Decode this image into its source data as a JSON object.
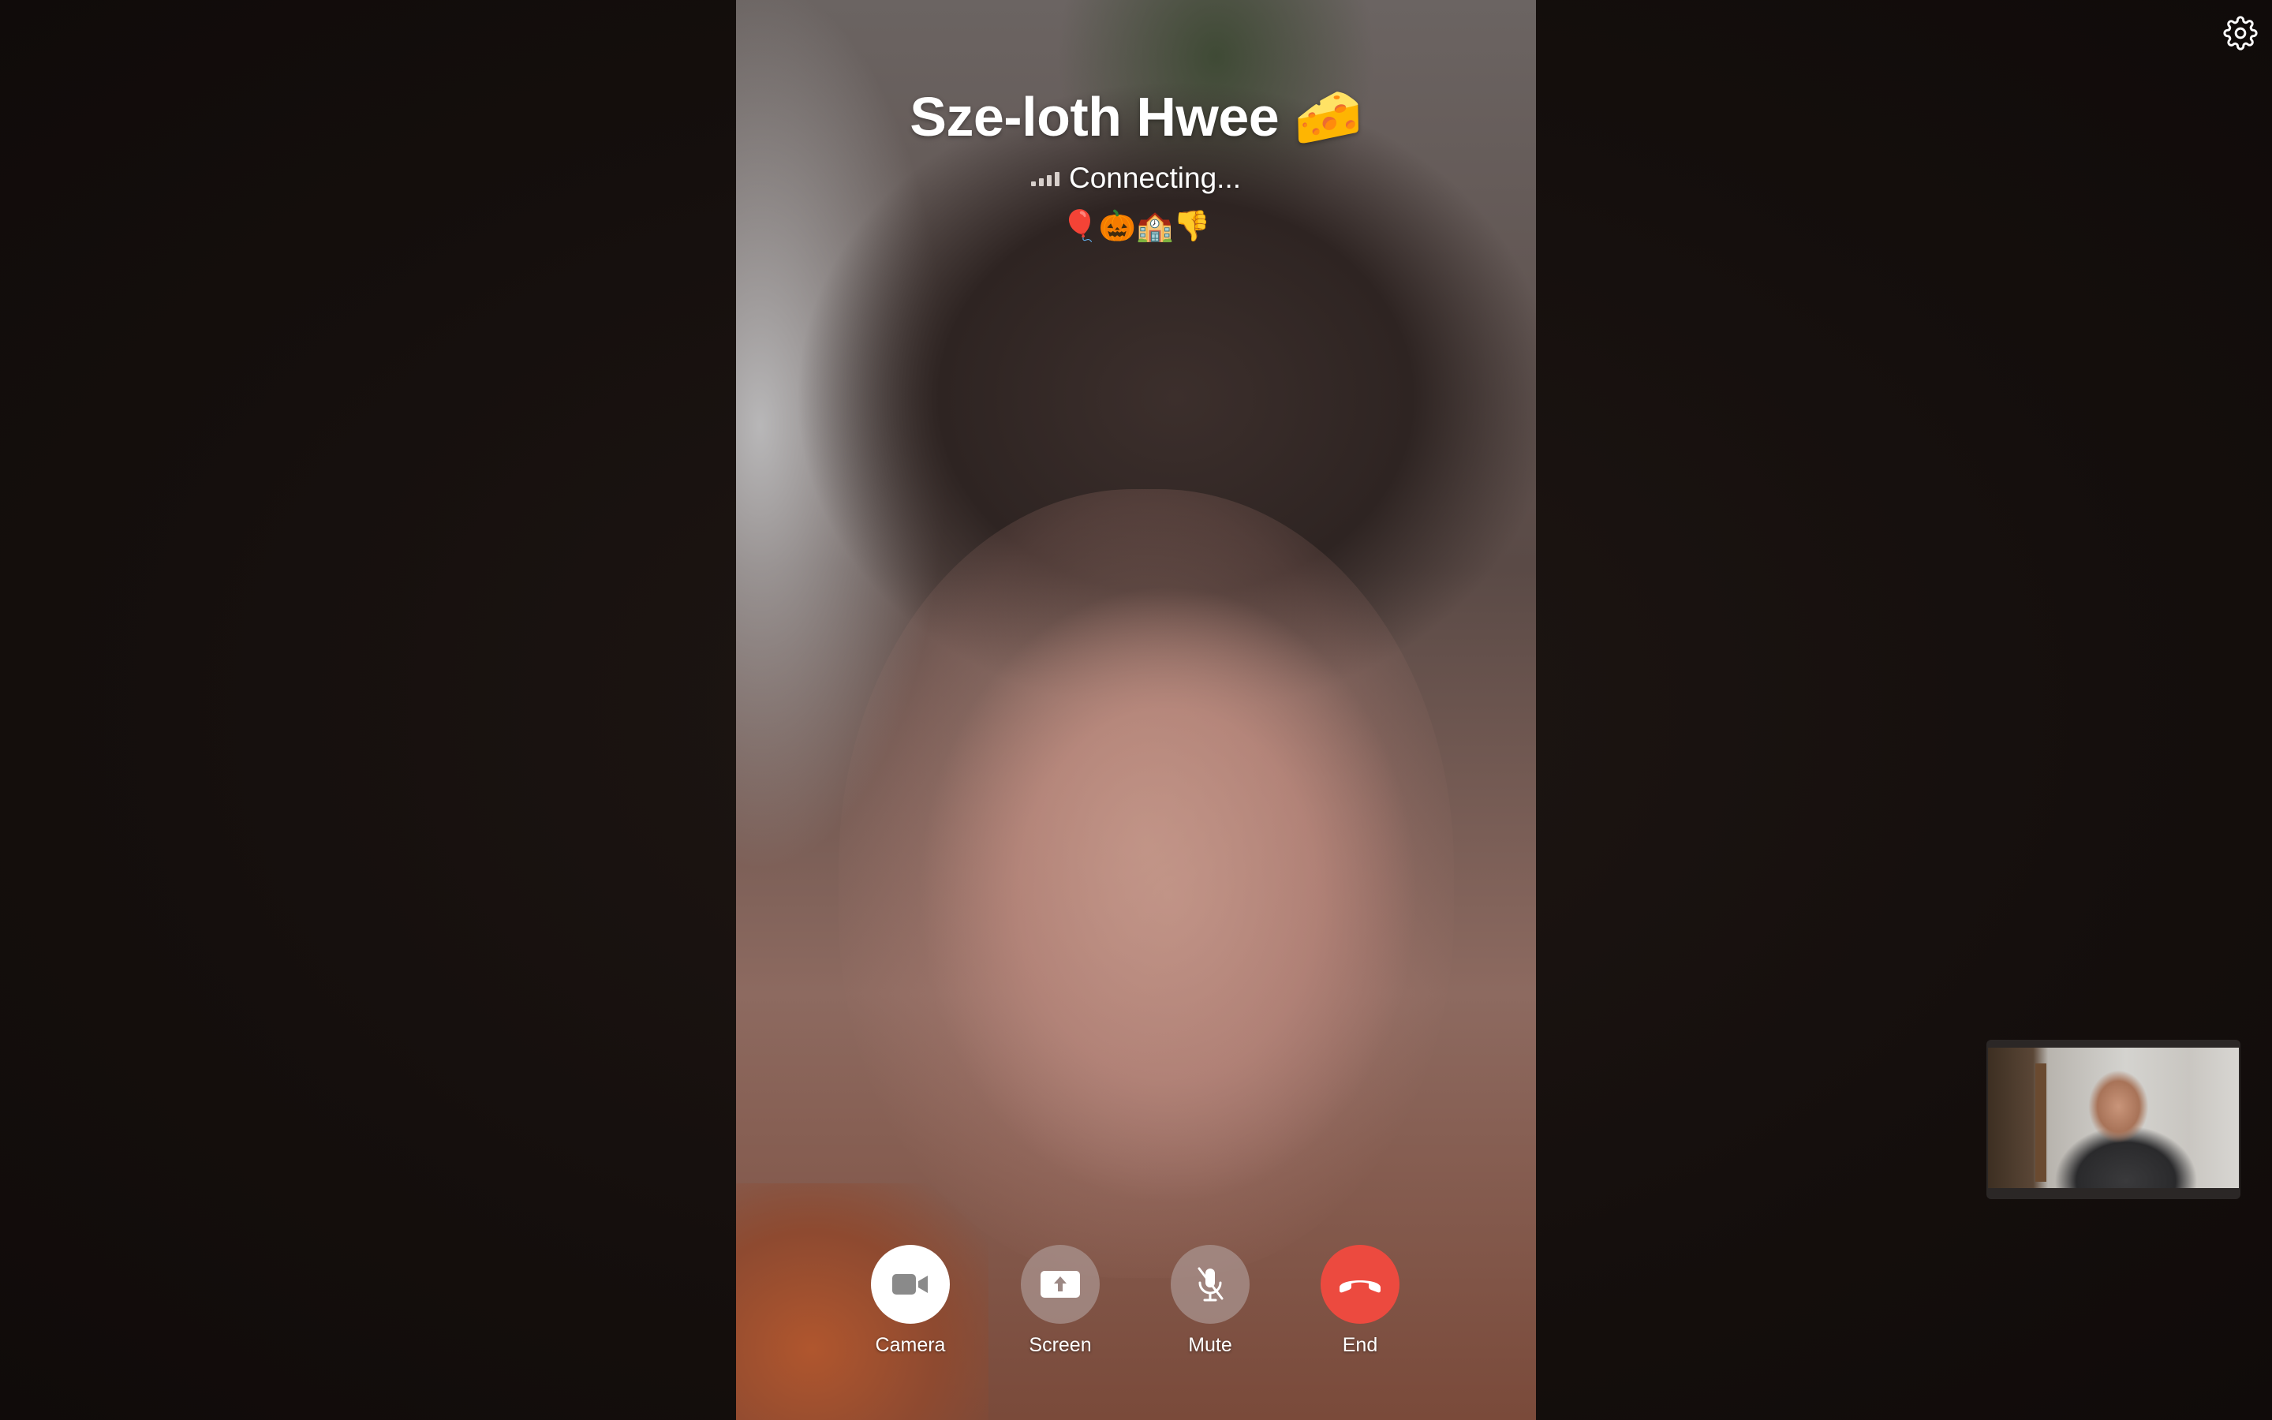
{
  "call": {
    "caller_name": "Sze-loth Hwee 🧀",
    "status": "Connecting...",
    "emojis": "🎈🎃🏫👎"
  },
  "controls": {
    "camera_label": "Camera",
    "screen_label": "Screen",
    "mute_label": "Mute",
    "end_label": "End"
  },
  "icons": {
    "settings": "gear-icon",
    "signal": "signal-bars-icon",
    "camera": "video-camera-icon",
    "screen": "screen-share-icon",
    "mute": "microphone-muted-icon",
    "end": "phone-hangup-icon"
  },
  "colors": {
    "end_button": "#ec4a3f",
    "camera_button": "#ffffff",
    "background": "#140f0d"
  }
}
